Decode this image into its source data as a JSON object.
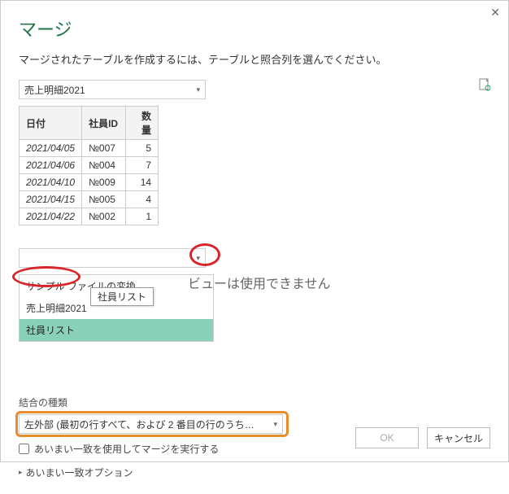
{
  "dialog": {
    "title": "マージ",
    "subtitle": "マージされたテーブルを作成するには、テーブルと照合列を選んでください。"
  },
  "top_dropdown": {
    "selected": "売上明細2021"
  },
  "table": {
    "headers": [
      "日付",
      "社員ID",
      "数量"
    ],
    "rows": [
      [
        "2021/04/05",
        "№007",
        "5"
      ],
      [
        "2021/04/06",
        "№004",
        "7"
      ],
      [
        "2021/04/10",
        "№009",
        "14"
      ],
      [
        "2021/04/15",
        "№005",
        "4"
      ],
      [
        "2021/04/22",
        "№002",
        "1"
      ]
    ]
  },
  "second_dropdown": {
    "selected": ""
  },
  "dropdown_list": {
    "items": [
      {
        "label": "サンプル ファイルの変換",
        "highlighted": false
      },
      {
        "label": "売上明細2021",
        "highlighted": false
      },
      {
        "label": "社員リスト",
        "highlighted": true
      }
    ],
    "tooltip": "社員リスト"
  },
  "preview_message": "ビューは使用できません",
  "join": {
    "section_label": "結合の種類",
    "selected": "左外部 (最初の行すべて、および 2 番目の行のうち…"
  },
  "fuzzy": {
    "checkbox_label": "あいまい一致を使用してマージを実行する",
    "checked": false,
    "expand_label": "あいまい一致オプション"
  },
  "buttons": {
    "ok": "OK",
    "cancel": "キャンセル"
  }
}
